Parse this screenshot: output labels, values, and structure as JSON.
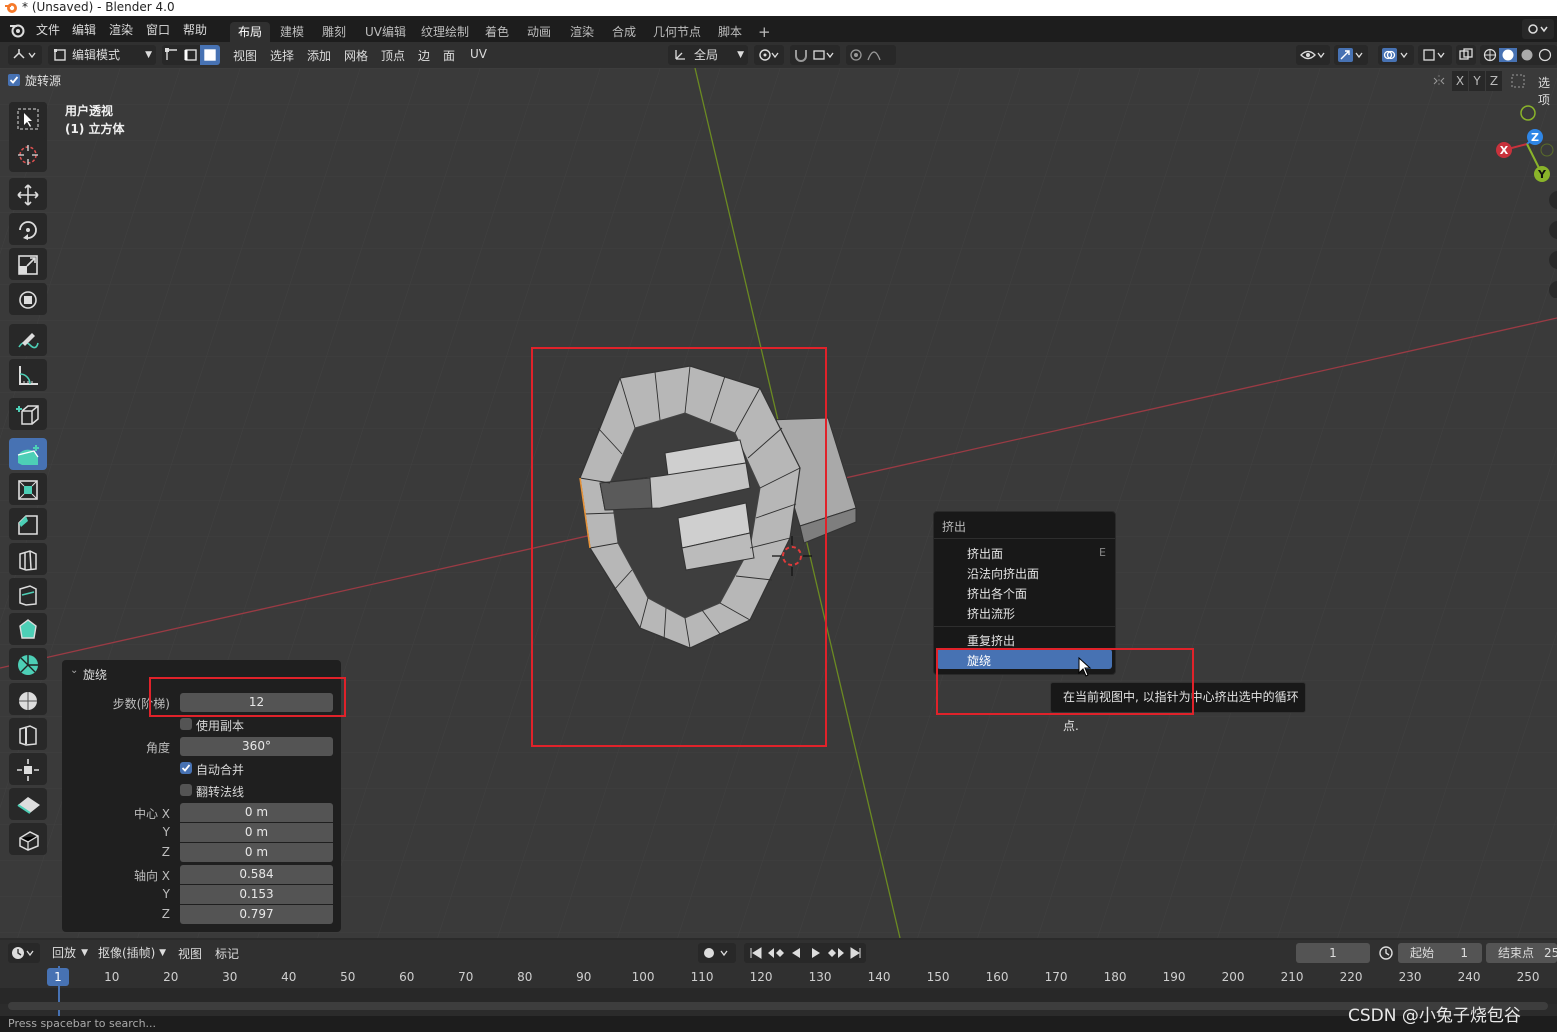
{
  "window": {
    "title": "* (Unsaved) - Blender 4.0"
  },
  "menubar": {
    "items": [
      "文件",
      "编辑",
      "渲染",
      "窗口",
      "帮助"
    ]
  },
  "workspaces": {
    "tabs": [
      "布局",
      "建模",
      "雕刻",
      "UV编辑",
      "纹理绘制",
      "着色",
      "动画",
      "渲染",
      "合成",
      "几何节点",
      "脚本"
    ],
    "active": "布局",
    "add": "+"
  },
  "header": {
    "mode": "编辑模式",
    "menus": [
      "视图",
      "选择",
      "添加",
      "网格",
      "顶点",
      "边",
      "面",
      "UV"
    ],
    "transform_orientation": "全局",
    "options_label": "选项",
    "axes": [
      "X",
      "Y",
      "Z"
    ]
  },
  "viewport": {
    "spin_source_label": "旋转源",
    "view_name": "用户透视",
    "object_name": "(1) 立方体",
    "gizmo": {
      "x": "X",
      "y": "Y",
      "z": "Z"
    }
  },
  "redo_panel": {
    "title": "旋绕",
    "steps_label": "步数(阶梯)",
    "steps_value": "12",
    "use_duplicates": "使用副本",
    "angle_label": "角度",
    "angle_value": "360°",
    "auto_merge": "自动合并",
    "flip_normals": "翻转法线",
    "center_label": "中心 X",
    "center_x": "0 m",
    "center_y": "0 m",
    "center_z": "0 m",
    "axis_label": "轴向 X",
    "axis_x": "0.584",
    "axis_y": "0.153",
    "axis_z": "0.797",
    "y_label": "Y",
    "z_label": "Z",
    "use_duplicates_checked": false,
    "auto_merge_checked": true,
    "flip_normals_checked": false
  },
  "extrude_menu": {
    "title": "挤出",
    "items": [
      "挤出面",
      "沿法向挤出面",
      "挤出各个面",
      "挤出流形"
    ],
    "shortcut": "E",
    "items2": [
      "重复挤出",
      "旋绕"
    ],
    "tooltip": "在当前视图中, 以指针为中心挤出选中的循环点."
  },
  "timeline": {
    "playback": "回放",
    "keying": "抠像(插帧)",
    "view": "视图",
    "marker": "标记",
    "current_frame": "1",
    "start_label": "起始",
    "start_value": "1",
    "end_label": "结束点",
    "end_value": "25",
    "playhead": "1",
    "ticks": [
      "10",
      "20",
      "30",
      "40",
      "50",
      "60",
      "70",
      "80",
      "90",
      "100",
      "110",
      "120",
      "130",
      "140",
      "150",
      "160",
      "170",
      "180",
      "190",
      "200",
      "210",
      "220",
      "230",
      "240",
      "250"
    ]
  },
  "status": {
    "hint": "Press spacebar to search..."
  },
  "watermark": "CSDN @小兔子烧包谷",
  "colors": {
    "accent": "#4772b3",
    "highlight_box": "#e0222a",
    "x_axis": "#c8323c",
    "y_axis": "#8ab42a",
    "z_axis": "#2f86e6"
  }
}
